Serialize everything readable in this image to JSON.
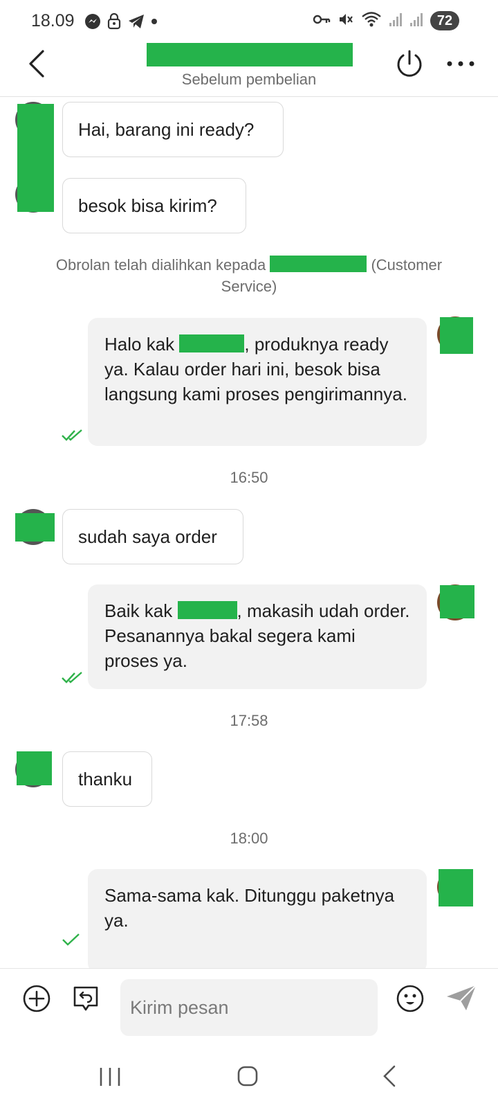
{
  "status_bar": {
    "time": "18.09",
    "battery": "72",
    "icons_left": [
      "messenger-icon",
      "vpn-lock-icon",
      "telegram-icon",
      "dot-icon"
    ],
    "icons_right": [
      "key-icon",
      "mute-icon",
      "wifi-icon",
      "signal-icon",
      "signal-icon"
    ]
  },
  "header": {
    "subtitle": "Sebelum pembelian"
  },
  "messages": {
    "m1": "Hai, barang ini ready?",
    "m2": "besok bisa kirim?",
    "system_prefix": "Obrolan telah dialihkan kepada",
    "system_suffix": "(Customer Service)",
    "m3_a": "Halo kak",
    "m3_b": ", produknya ready ya. Kalau order hari ini, besok bisa langsung kami proses pengirimannya.",
    "time1": "16:50",
    "m4": "sudah saya order",
    "m5_a": "Baik kak",
    "m5_b": ", makasih udah order. Pesanannya bakal segera kami proses ya.",
    "time2": "17:58",
    "m6": "thanku",
    "time3": "18:00",
    "m7": "Sama-sama kak. Ditunggu paketnya ya."
  },
  "composer": {
    "placeholder": "Kirim pesan"
  },
  "colors": {
    "redaction": "#25b34b",
    "read_check": "#2fb24a",
    "outgoing_bubble": "#f2f2f2"
  }
}
